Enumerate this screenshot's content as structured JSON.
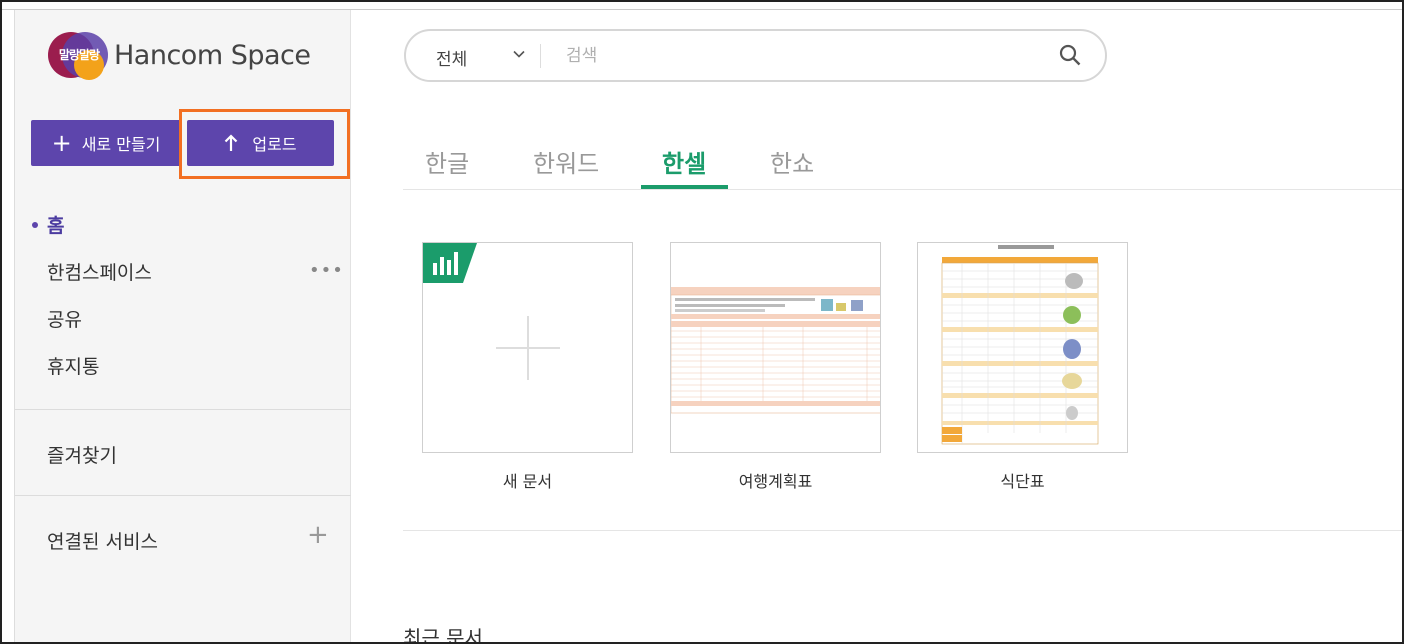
{
  "logo": {
    "badge_text": "말랑말랑",
    "brand": "Hancom Space"
  },
  "actions": {
    "new_label": "새로 만들기",
    "upload_label": "업로드"
  },
  "nav": {
    "home": "홈",
    "hancom_space": "한컴스페이스",
    "shared": "공유",
    "trash": "휴지통",
    "favorites": "즐겨찾기",
    "connected_services": "연결된 서비스"
  },
  "search": {
    "scope": "전체",
    "placeholder": "검색"
  },
  "tabs": [
    {
      "label": "한글"
    },
    {
      "label": "한워드"
    },
    {
      "label": "한셀"
    },
    {
      "label": "한쇼"
    }
  ],
  "active_tab": "한셀",
  "templates": [
    {
      "label": "새 문서"
    },
    {
      "label": "여행계획표"
    },
    {
      "label": "식단표"
    }
  ],
  "recent": {
    "title": "최근 문서"
  },
  "colors": {
    "accent": "#5d45ac",
    "tab_active": "#1b9c6b",
    "highlight": "#f26f22"
  }
}
